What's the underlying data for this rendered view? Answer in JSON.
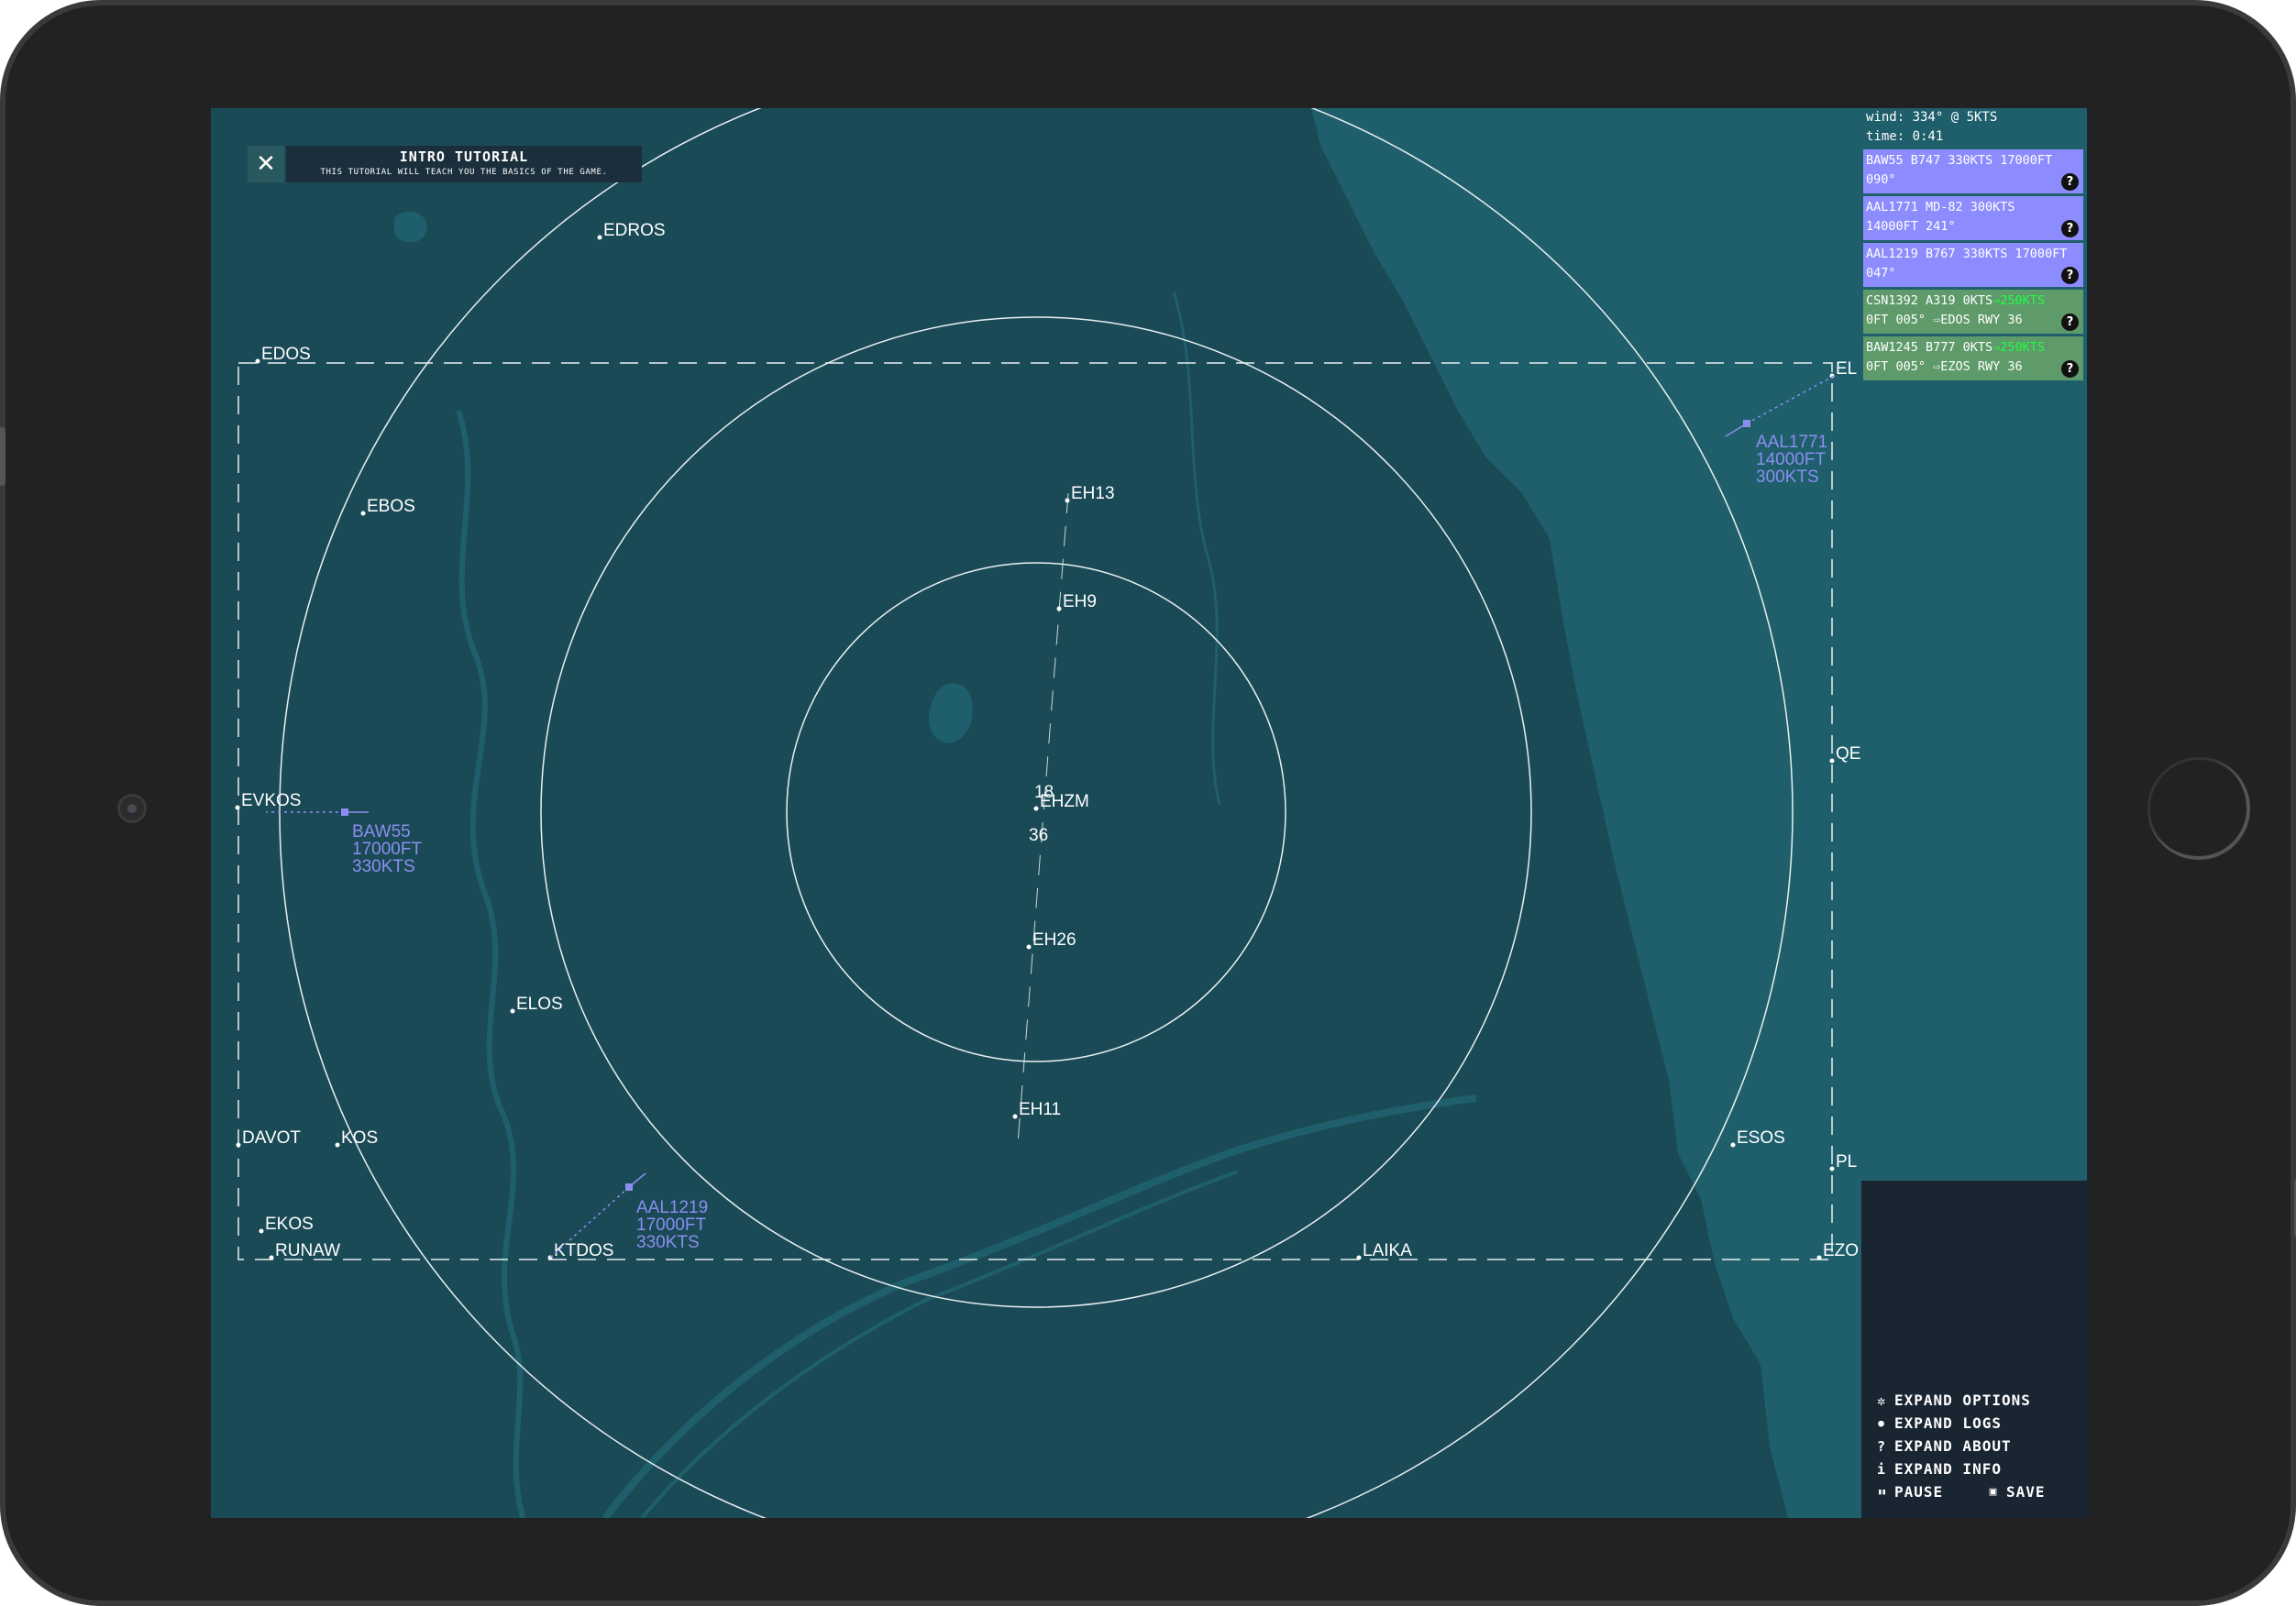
{
  "tutorial": {
    "close_icon": "✕",
    "title": "INTRO TUTORIAL",
    "subtitle": "THIS TUTORIAL WILL TEACH YOU THE BASICS OF THE GAME."
  },
  "fixes": [
    {
      "name": "EDROS"
    },
    {
      "name": "EDOS"
    },
    {
      "name": "EBOS"
    },
    {
      "name": "EVKOS"
    },
    {
      "name": "ELOS"
    },
    {
      "name": "DAVOT"
    },
    {
      "name": "KOS"
    },
    {
      "name": "EKOS"
    },
    {
      "name": "RUNAW"
    },
    {
      "name": "KTDOS"
    },
    {
      "name": "LAIKA"
    },
    {
      "name": "ESOS"
    },
    {
      "name": "EZO"
    },
    {
      "name": "PL"
    },
    {
      "name": "QE"
    },
    {
      "name": "EL"
    },
    {
      "name": "EH13"
    },
    {
      "name": "EH9"
    },
    {
      "name": "EHZM"
    },
    {
      "name": "EH26"
    },
    {
      "name": "EH11"
    }
  ],
  "runway": {
    "north_label": "18",
    "south_label": "36"
  },
  "aircraft": [
    {
      "callsign": "BAW55",
      "altitude": "17000FT",
      "speed": "330KTS"
    },
    {
      "callsign": "AAL1771",
      "altitude": "14000FT",
      "speed": "300KTS"
    },
    {
      "callsign": "AAL1219",
      "altitude": "17000FT",
      "speed": "330KTS"
    }
  ],
  "status": {
    "wind": "wind: 334° @ 5KTS",
    "time": "time: 0:41"
  },
  "strips": [
    {
      "kind": "arrival",
      "line1": "BAW55 B747 330KTS 17000FT",
      "line2": "090°"
    },
    {
      "kind": "arrival",
      "line1": "AAL1771 MD-82 300KTS",
      "line2": "14000FT 241°"
    },
    {
      "kind": "arrival",
      "line1": "AAL1219 B767 330KTS 17000FT",
      "line2": "047°"
    },
    {
      "kind": "departure",
      "line1": "CSN1392 A319 0KTS",
      "line1_hl": "⇒250KTS",
      "line2": "0FT 005° ⇨EDOS RWY 36"
    },
    {
      "kind": "departure",
      "line1": "BAW1245 B777 0KTS",
      "line1_hl": "⇒250KTS",
      "line2": "0FT 005° ⇨EZOS RWY 36"
    }
  ],
  "help_glyph": "?",
  "menu": {
    "options": {
      "icon": "gear-icon",
      "glyph": "✲",
      "label": "EXPAND OPTIONS"
    },
    "logs": {
      "icon": "chat-icon",
      "glyph": "●",
      "label": "EXPAND LOGS"
    },
    "about": {
      "icon": "question-icon",
      "glyph": "?",
      "label": "EXPAND ABOUT"
    },
    "info": {
      "icon": "info-icon",
      "glyph": "i",
      "label": "EXPAND INFO"
    },
    "pause": {
      "icon": "pause-icon",
      "glyph": "▮▮",
      "label": "PAUSE"
    },
    "save": {
      "icon": "save-icon",
      "glyph": "▣",
      "label": "SAVE"
    }
  },
  "colors": {
    "map_land": "#1a4a56",
    "map_water": "#1f5f6c",
    "arrival_strip": "#8c8cff",
    "departure_strip": "#5e9a6a",
    "aircraft": "#8b8ef0",
    "highlight": "#22ff44"
  }
}
